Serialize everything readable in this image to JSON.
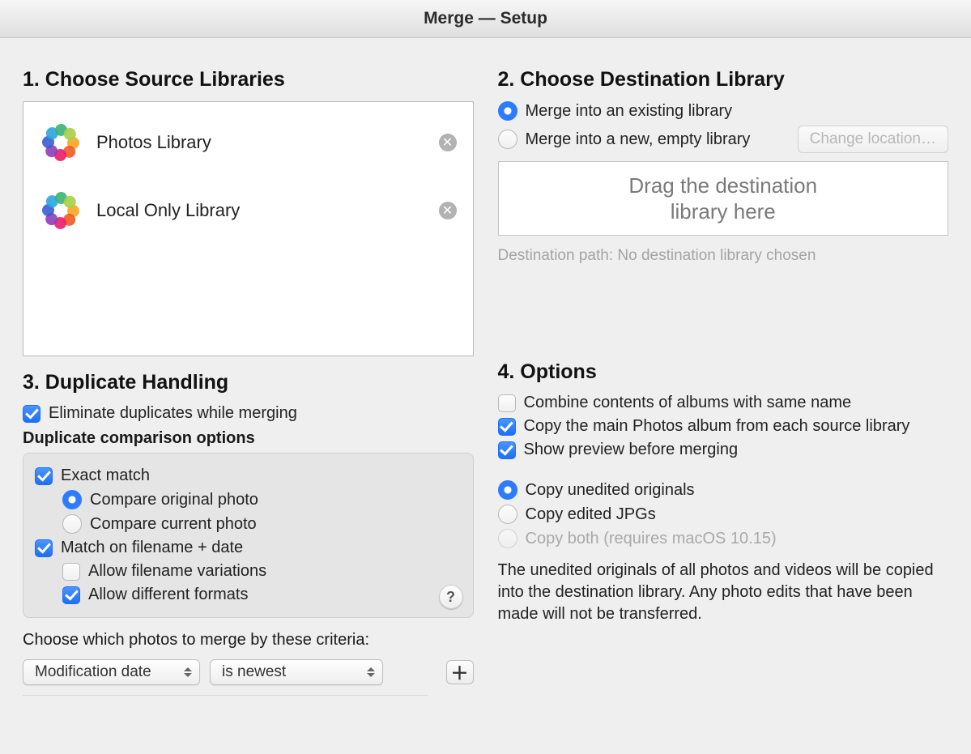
{
  "window": {
    "title": "Merge — Setup"
  },
  "section1": {
    "heading": "1. Choose Source Libraries",
    "libraries": [
      {
        "name": "Photos Library"
      },
      {
        "name": "Local Only Library"
      }
    ]
  },
  "section2": {
    "heading": "2. Choose Destination Library",
    "radio_existing": "Merge into an existing library",
    "radio_new": "Merge into a new, empty library",
    "change_location": "Change location…",
    "drop_hint": "Drag the destination\nlibrary here",
    "dest_path_label": "Destination path: No destination library chosen"
  },
  "section3": {
    "heading": "3. Duplicate Handling",
    "eliminate": "Eliminate duplicates while merging",
    "cmp_heading": "Duplicate comparison options",
    "exact_match": "Exact match",
    "cmp_original": "Compare original photo",
    "cmp_current": "Compare current photo",
    "match_fn_date": "Match on filename + date",
    "allow_fn_var": "Allow filename variations",
    "allow_formats": "Allow different formats",
    "criteria_label": "Choose which photos to merge by these criteria:",
    "criteria_field": "Modification date",
    "criteria_op": "is newest"
  },
  "section4": {
    "heading": "4. Options",
    "combine_albums": "Combine contents of albums with same name",
    "copy_main_album": "Copy the main Photos album from each source library",
    "show_preview": "Show preview before merging",
    "copy_unedited": "Copy unedited originals",
    "copy_edited": "Copy edited JPGs",
    "copy_both": "Copy both (requires macOS 10.15)",
    "explanation": "The unedited originals of all photos and videos will be copied into the destination library. Any photo edits that have been made will not be transferred."
  }
}
